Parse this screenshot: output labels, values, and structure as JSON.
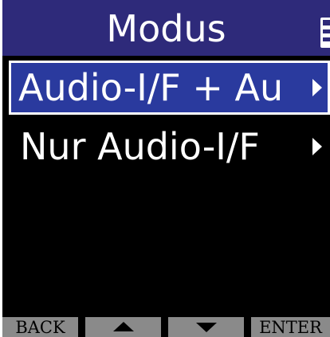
{
  "header": {
    "title": "Modus",
    "battery_icon": "battery-icon"
  },
  "menu": {
    "items": [
      {
        "label": "Audio-I/F + Au",
        "selected": true,
        "icon": "chevron-right-icon"
      },
      {
        "label": "Nur Audio-I/F",
        "selected": false,
        "icon": "chevron-right-icon"
      }
    ]
  },
  "footer": {
    "back_label": "BACK",
    "up_icon": "up-arrow-icon",
    "down_icon": "down-arrow-icon",
    "enter_label": "ENTER"
  },
  "colors": {
    "header_bg": "#2e2a7a",
    "selection_bg": "#2a3a9e",
    "screen_bg": "#000000",
    "footer_button_bg": "#8a8a8a",
    "text": "#ffffff"
  }
}
